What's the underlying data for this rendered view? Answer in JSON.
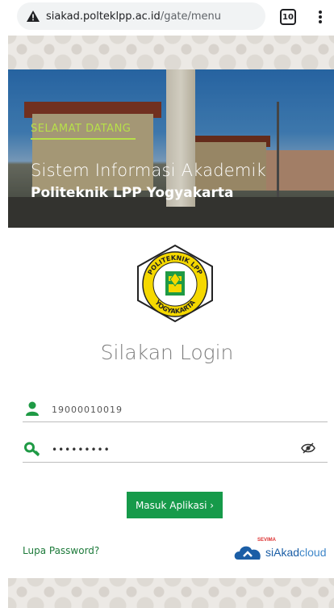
{
  "browser": {
    "url_host": "siakad.polteklpp.ac.id",
    "url_path": "/gate/menu",
    "tab_count": "10"
  },
  "hero": {
    "welcome": "SELAMAT DATANG",
    "title": "Sistem Informasi Akademik",
    "subtitle": "Politeknik LPP Yogyakarta"
  },
  "logo": {
    "top_text": "POLITEKNIK LPP",
    "bottom_text": "YOGYAKARTA"
  },
  "login": {
    "title": "Silakan Login",
    "username_value": "19000010019",
    "password_value": "•••••••••",
    "submit_label": "Masuk Aplikasi ›",
    "forgot_label": "Lupa Password?"
  },
  "brand": {
    "tag": "SEVIMA",
    "name_main": "siAkad",
    "name_suffix": "cloud"
  },
  "colors": {
    "primary_green": "#169a4a",
    "icon_green": "#1f9a45",
    "welcome_lime": "#b7e04a",
    "brand_blue": "#1b5ea6"
  },
  "icons": [
    "warning-icon",
    "tabs-icon",
    "more-vert-icon",
    "user-icon",
    "key-icon",
    "eye-slash-icon",
    "cloud-icon"
  ]
}
